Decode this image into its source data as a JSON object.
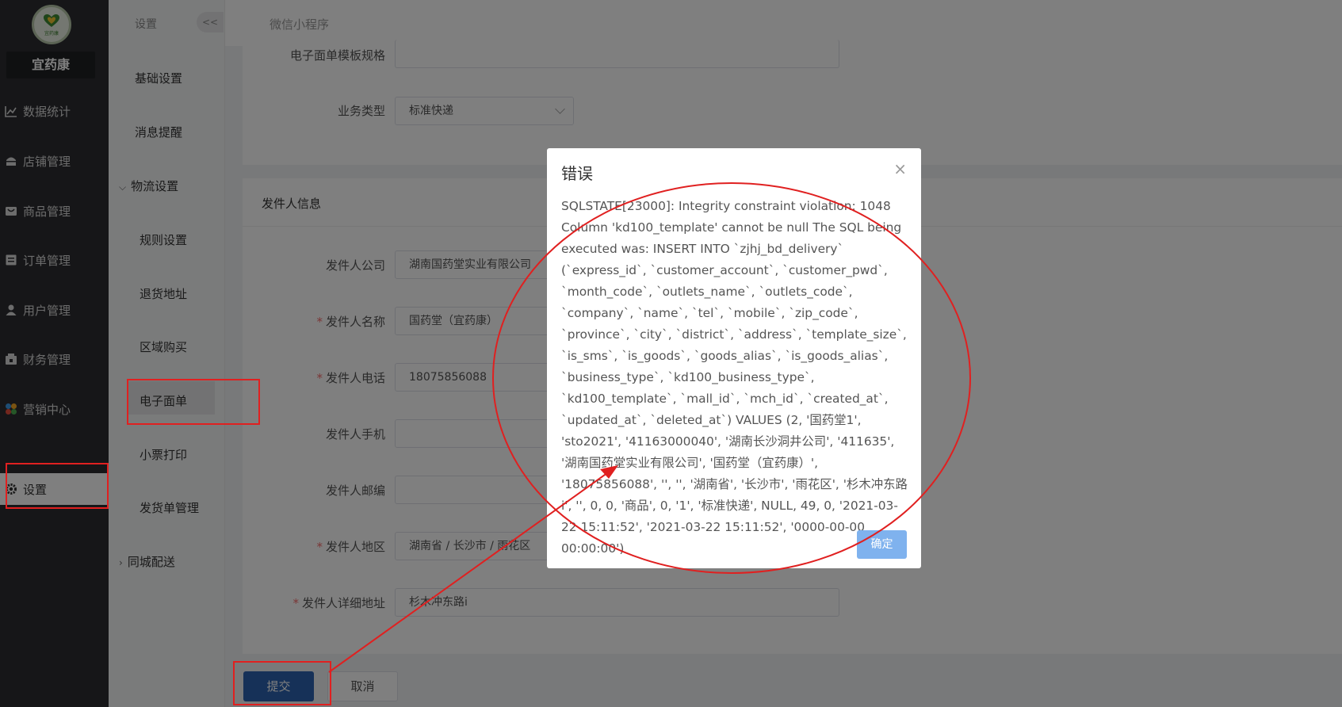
{
  "brand": {
    "name": "宜药康",
    "logo_text": "宜药康"
  },
  "nav": {
    "items": [
      {
        "label": "数据统计",
        "icon": "chart-icon"
      },
      {
        "label": "店铺管理",
        "icon": "store-icon"
      },
      {
        "label": "商品管理",
        "icon": "goods-icon"
      },
      {
        "label": "订单管理",
        "icon": "order-icon"
      },
      {
        "label": "用户管理",
        "icon": "user-icon"
      },
      {
        "label": "财务管理",
        "icon": "finance-icon"
      },
      {
        "label": "营销中心",
        "icon": "marketing-icon"
      },
      {
        "label": "设置",
        "icon": "gear-icon"
      }
    ]
  },
  "subnav": {
    "title": "设置",
    "collapse": "<<",
    "items": [
      {
        "label": "基础设置"
      },
      {
        "label": "消息提醒"
      },
      {
        "label": "物流设置"
      },
      {
        "label": "规则设置"
      },
      {
        "label": "退货地址"
      },
      {
        "label": "区域购买"
      },
      {
        "label": "电子面单"
      },
      {
        "label": "小票打印"
      },
      {
        "label": "发货单管理"
      },
      {
        "label": "同城配送"
      }
    ]
  },
  "topbar": {
    "title": "微信小程序"
  },
  "form_top": {
    "template_label": "电子面单模板规格",
    "business_label": "业务类型",
    "business_value": "标准快递"
  },
  "sender": {
    "section_title": "发件人信息",
    "company_label": "发件人公司",
    "company_value": "湖南国药堂实业有限公司",
    "name_label": "发件人名称",
    "name_value": "国药堂（宜药康）",
    "phone_label": "发件人电话",
    "phone_value": "18075856088",
    "mobile_label": "发件人手机",
    "zip_label": "发件人邮编",
    "region_label": "发件人地区",
    "region_value": "湖南省 / 长沙市 / 雨花区",
    "address_label": "发件人详细地址",
    "address_value": "杉木冲东路i"
  },
  "actions": {
    "submit": "提交",
    "cancel": "取消"
  },
  "dialog": {
    "title": "错误",
    "close": "×",
    "message": "SQLSTATE[23000]: Integrity constraint violation: 1048 Column 'kd100_template' cannot be null The SQL being executed was: INSERT INTO `zjhj_bd_delivery` (`express_id`, `customer_account`, `customer_pwd`, `month_code`, `outlets_name`, `outlets_code`, `company`, `name`, `tel`, `mobile`, `zip_code`, `province`, `city`, `district`, `address`, `template_size`, `is_sms`, `is_goods`, `goods_alias`, `is_goods_alias`, `business_type`, `kd100_business_type`, `kd100_template`, `mall_id`, `mch_id`, `created_at`, `updated_at`, `deleted_at`) VALUES (2, '国药堂1', 'sto2021', '41163000040', '湖南长沙洞井公司', '411635', '湖南国药堂实业有限公司', '国药堂（宜药康）', '18075856088', '', '', '湖南省', '长沙市', '雨花区', '杉木冲东路i', '', 0, 0, '商品', 0, '1', '标准快递', NULL, 49, 0, '2021-03-22 15:11:52', '2021-03-22 15:11:52', '0000-00-00 00:00:00')",
    "ok": "确定"
  },
  "colors": {
    "nav_bg": "#2c2d30",
    "primary": "#2d63b0",
    "annotation": "#e02020",
    "dialog_ok": "#7fb2ee"
  }
}
